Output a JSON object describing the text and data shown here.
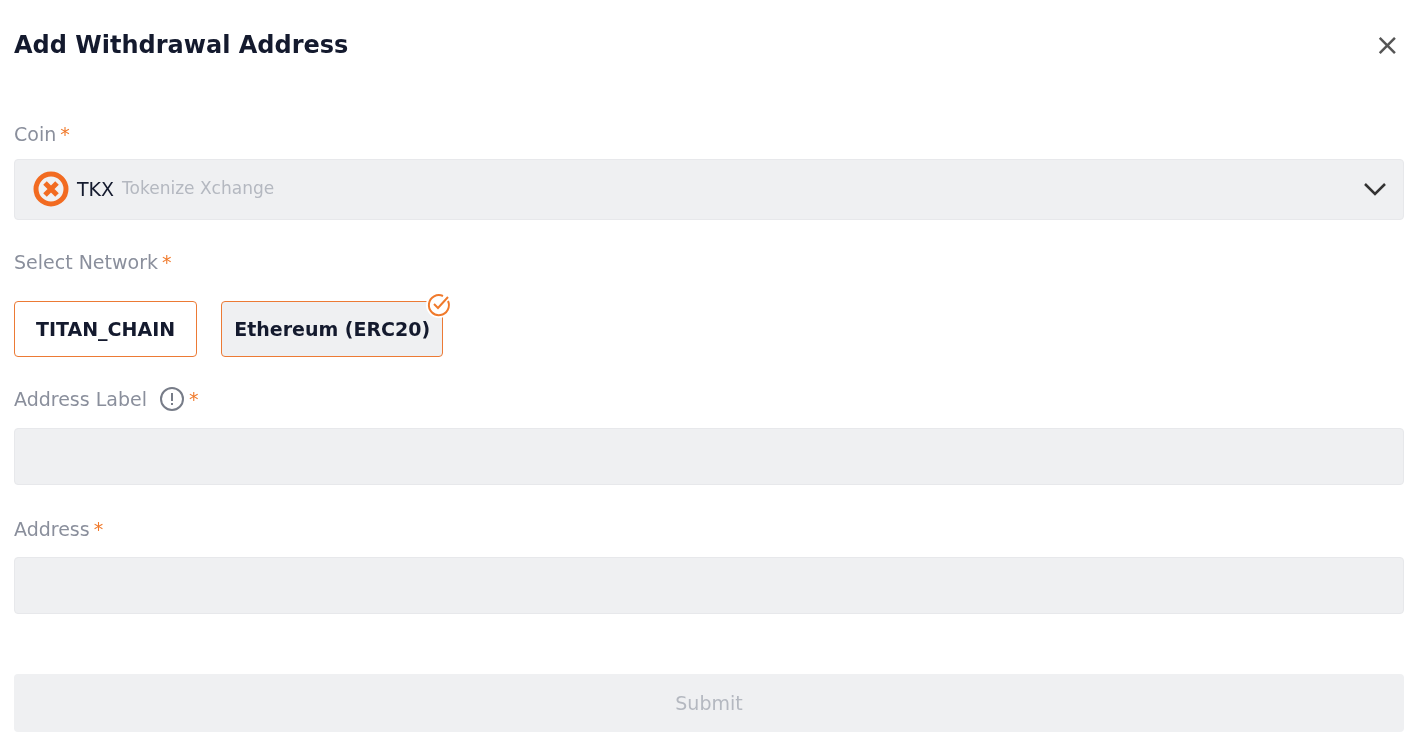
{
  "dialog": {
    "title": "Add Withdrawal Address",
    "close_icon": "×"
  },
  "coin": {
    "label": "Coin",
    "required_mark": "*",
    "symbol": "TKX",
    "name": "Tokenize Xchange"
  },
  "network": {
    "label": "Select Network",
    "required_mark": "*",
    "options": [
      {
        "label": "TITAN_CHAIN",
        "selected": false
      },
      {
        "label": "Ethereum (ERC20)",
        "selected": true
      }
    ]
  },
  "fields": [
    {
      "label": "Address Label",
      "required_mark": "*",
      "info": true
    },
    {
      "label": "Address",
      "required_mark": "*",
      "info": false
    }
  ],
  "submit": {
    "label": "Submit",
    "disabled": true
  }
}
